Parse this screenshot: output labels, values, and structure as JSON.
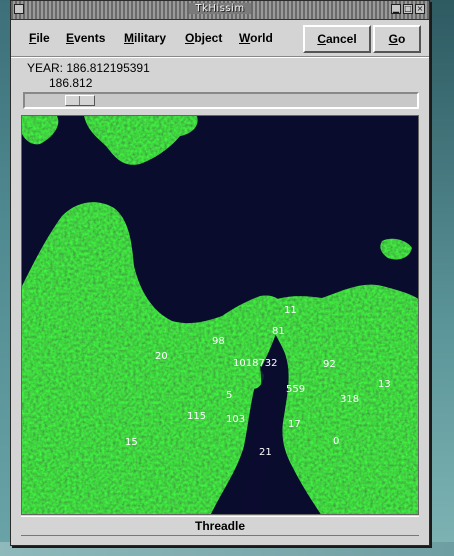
{
  "window": {
    "title": "TkHissim"
  },
  "menubar": {
    "items": [
      {
        "label": "File",
        "ul": "F",
        "rest": "ile"
      },
      {
        "label": "Events",
        "ul": "E",
        "rest": "vents"
      },
      {
        "label": "Military",
        "ul": "M",
        "rest": "ilitary"
      },
      {
        "label": "Object",
        "ul": "O",
        "rest": "bject"
      },
      {
        "label": "World",
        "ul": "W",
        "rest": "orld"
      }
    ]
  },
  "buttons": {
    "cancel": {
      "label": "Cancel",
      "ul": "C",
      "rest": "ancel"
    },
    "go": {
      "label": "Go",
      "ul": "G",
      "rest": "o"
    }
  },
  "year": {
    "label": "YEAR: 186.812195391",
    "value": "186.812"
  },
  "slider": {
    "value": 0.11
  },
  "map": {
    "colors": {
      "water": "#0a0c2e",
      "land": "#1f8a1f",
      "land_dark": "#0f5a12",
      "land_light": "#3bbf3b"
    },
    "region_labels": [
      "11",
      "81",
      "98",
      "20",
      "1018732",
      "92",
      "5",
      "559",
      "13",
      "318",
      "115",
      "103",
      "17",
      "15",
      "0",
      "21"
    ]
  },
  "status": {
    "text": "Threadle"
  },
  "icons": [
    "window-menu-icon",
    "minimize-icon",
    "maximize-icon",
    "close-icon"
  ]
}
